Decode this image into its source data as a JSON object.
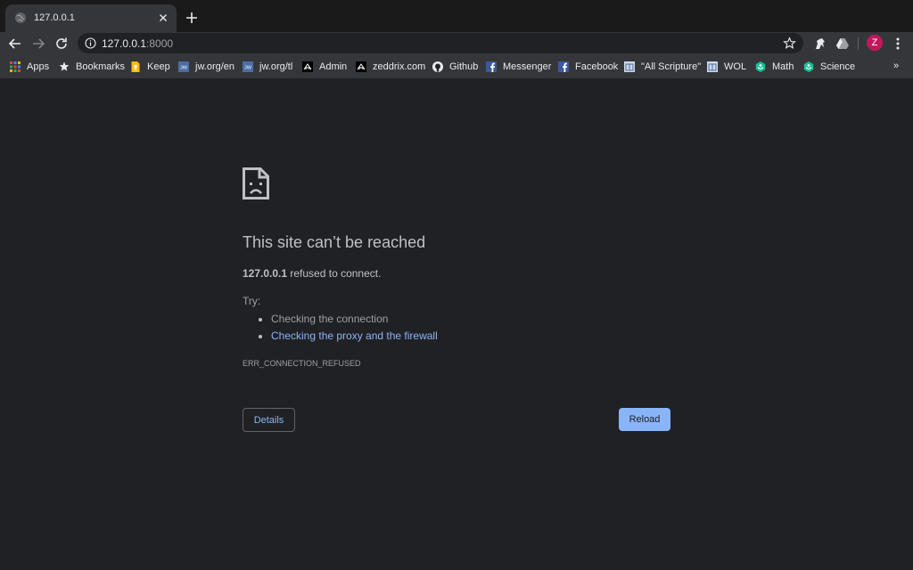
{
  "tab": {
    "title": "127.0.0.1"
  },
  "omnibox": {
    "host": "127.0.0.1",
    "port": ":8000"
  },
  "profile": {
    "initial": "Z",
    "color": "#c2185b"
  },
  "bookmarks": [
    {
      "label": "Apps",
      "icon": "apps-grid-icon"
    },
    {
      "label": "Bookmarks",
      "icon": "star-icon"
    },
    {
      "label": "Keep",
      "icon": "keep-icon"
    },
    {
      "label": "jw.org/en",
      "icon": "jw-icon"
    },
    {
      "label": "jw.org/tl",
      "icon": "jw-icon"
    },
    {
      "label": "Admin",
      "icon": "zeddrix-icon"
    },
    {
      "label": "zeddrix.com",
      "icon": "zeddrix-icon"
    },
    {
      "label": "Github",
      "icon": "github-icon"
    },
    {
      "label": "Messenger",
      "icon": "facebook-icon"
    },
    {
      "label": "Facebook",
      "icon": "facebook-icon"
    },
    {
      "label": "\"All Scripture\"",
      "icon": "wol-icon"
    },
    {
      "label": "WOL",
      "icon": "wol-icon"
    },
    {
      "label": "Math",
      "icon": "khan-icon"
    },
    {
      "label": "Science",
      "icon": "khan-icon"
    }
  ],
  "bookmarks_more": "»",
  "error": {
    "title": "This site can’t be reached",
    "host": "127.0.0.1",
    "message": " refused to connect.",
    "try_label": "Try:",
    "suggestions": [
      "Checking the connection",
      "Checking the proxy and the firewall"
    ],
    "code": "ERR_CONNECTION_REFUSED",
    "details_label": "Details",
    "reload_label": "Reload"
  },
  "colors": {
    "link": "#8ab4f8",
    "background": "#202124",
    "toolbar": "#35363a"
  }
}
